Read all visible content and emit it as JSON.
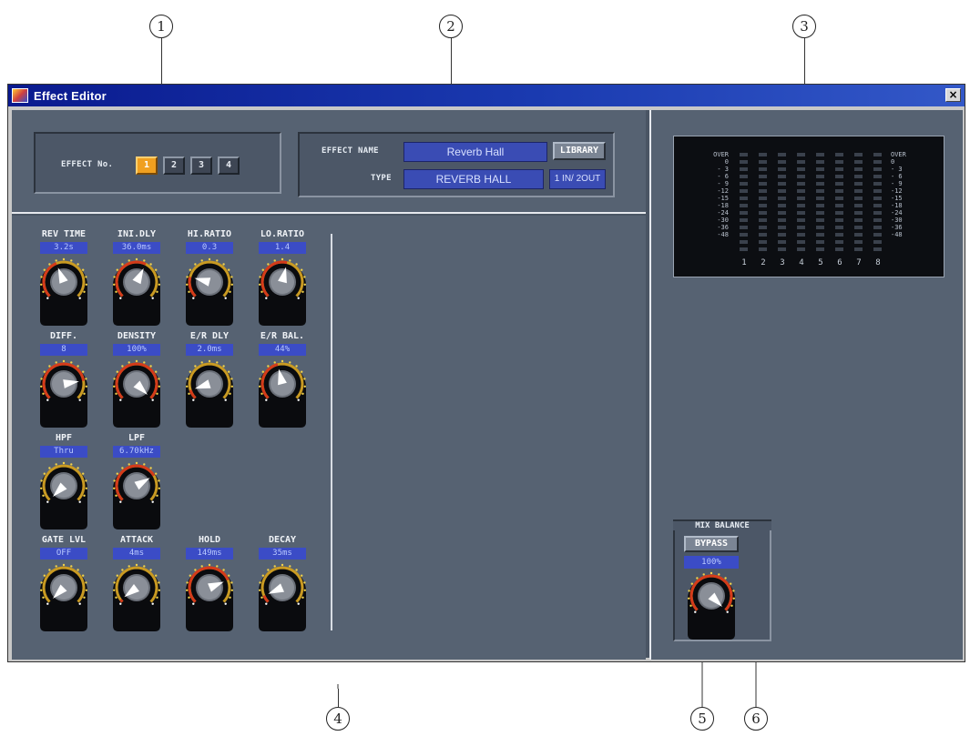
{
  "callouts": [
    "1",
    "2",
    "3",
    "4",
    "5",
    "6"
  ],
  "window": {
    "title": "Effect Editor",
    "close_glyph": "×",
    "effect_no": {
      "label": "EFFECT No.",
      "buttons": [
        "1",
        "2",
        "3",
        "4"
      ],
      "selected": "1"
    },
    "effect_name": {
      "label": "EFFECT NAME",
      "value": "Reverb Hall",
      "library_button": "LIBRARY"
    },
    "type": {
      "label": "TYPE",
      "value": "REVERB HALL",
      "io": "1 IN/ 2OUT"
    },
    "meter": {
      "scale": [
        "OVER",
        "0",
        "- 3",
        "- 6",
        "- 9",
        "-12",
        "-15",
        "-18",
        "-24",
        "-30",
        "-36",
        "-48"
      ],
      "channels": [
        "1",
        "2",
        "3",
        "4",
        "5",
        "6",
        "7",
        "8"
      ]
    },
    "params": [
      {
        "name": "REV TIME",
        "value": "3.2s",
        "pos": 0.42
      },
      {
        "name": "INI.DLY",
        "value": "36.0ms",
        "pos": 0.6
      },
      {
        "name": "HI.RATIO",
        "value": "0.3",
        "pos": 0.22
      },
      {
        "name": "LO.RATIO",
        "value": "1.4",
        "pos": 0.55
      },
      {
        "name": "DIFF.",
        "value": "8",
        "pos": 0.8
      },
      {
        "name": "DENSITY",
        "value": "100%",
        "pos": 1.0
      },
      {
        "name": "E/R DLY",
        "value": "2.0ms",
        "pos": 0.1
      },
      {
        "name": "E/R BAL.",
        "value": "44%",
        "pos": 0.45
      },
      {
        "name": "HPF",
        "value": "Thru",
        "pos": 0.0
      },
      {
        "name": "LPF",
        "value": "6.70kHz",
        "pos": 0.72
      },
      {
        "name": "GATE LVL",
        "value": "OFF",
        "pos": 0.0
      },
      {
        "name": "ATTACK",
        "value": "4ms",
        "pos": 0.03
      },
      {
        "name": "HOLD",
        "value": "149ms",
        "pos": 0.75
      },
      {
        "name": "DECAY",
        "value": "35ms",
        "pos": 0.08
      }
    ],
    "mix_balance": {
      "label": "MIX BALANCE",
      "bypass_button": "BYPASS",
      "value": "100%",
      "pos": 1.0
    }
  }
}
